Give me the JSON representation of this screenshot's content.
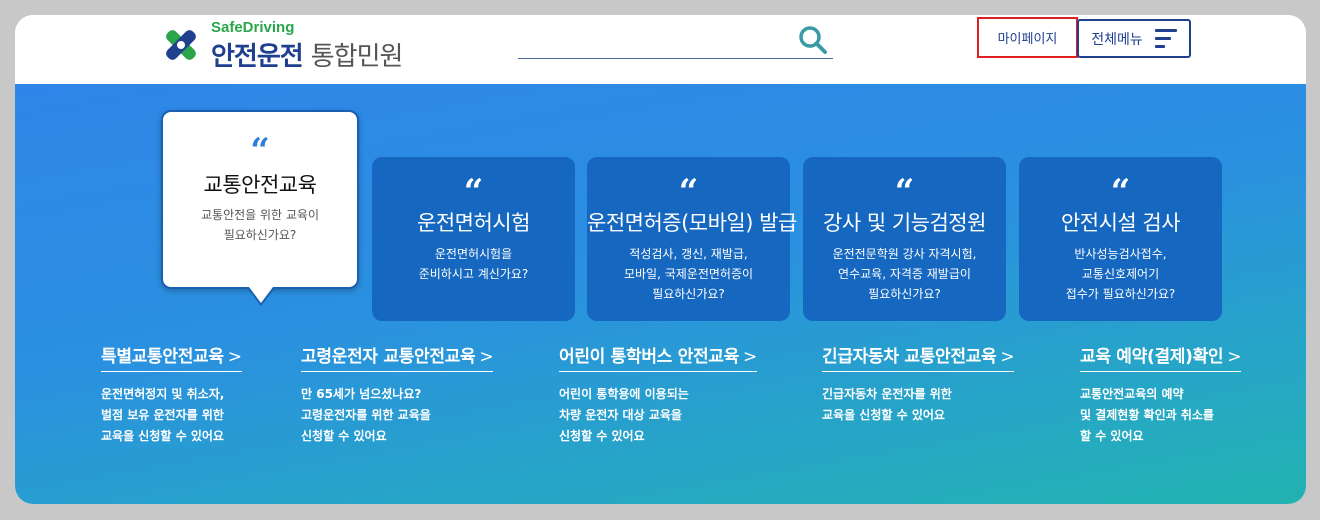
{
  "logo": {
    "en": "SafeDriving",
    "ko_main": "안전운전",
    "ko_sub": "통합민원"
  },
  "search": {
    "placeholder": ""
  },
  "header": {
    "mypage_label": "마이페이지",
    "menu_label": "전체메뉴"
  },
  "cards": [
    {
      "quote": "“",
      "title": "교통안전교육",
      "desc": "교통안전을 위한 교육이\n필요하신가요?"
    },
    {
      "quote": "“",
      "title": "운전면허시험",
      "desc": "운전면허시험을\n준비하시고 계신가요?"
    },
    {
      "quote": "“",
      "title": "운전면허증(모바일) 발급",
      "desc": "적성검사, 갱신, 재발급,\n모바일, 국제운전면허증이\n필요하신가요?"
    },
    {
      "quote": "“",
      "title": "강사 및 기능검정원",
      "desc": "운전전문학원 강사 자격시험,\n연수교육, 자격증 재발급이\n필요하신가요?"
    },
    {
      "quote": "“",
      "title": "안전시설 검사",
      "desc": "반사성능검사접수,\n교통신호제어기\n접수가 필요하신가요?"
    }
  ],
  "links": [
    {
      "title": "특별교통안전교육",
      "arrow": ">",
      "desc": "운전면허정지 및 취소자,\n벌점 보유 운전자를 위한\n교육을 신청할 수 있어요"
    },
    {
      "title": "고령운전자 교통안전교육",
      "arrow": ">",
      "desc": "만 65세가 넘으셨나요?\n고령운전자를 위한 교육을\n신청할 수 있어요"
    },
    {
      "title": "어린이 통학버스 안전교육",
      "arrow": ">",
      "desc": "어린이 통학용에 이용되는\n차량 운전자 대상 교육을\n신청할 수 있어요"
    },
    {
      "title": "긴급자동차 교통안전교육",
      "arrow": ">",
      "desc": "긴급자동차 운전자를 위한\n교육을 신청할 수 있어요"
    },
    {
      "title": "교육 예약(결제)확인",
      "arrow": ">",
      "desc": "교통안전교육의 예약\n및 결제현황 확인과 취소를\n할 수 있어요"
    }
  ],
  "colors": {
    "brand_blue": "#1f3f8f",
    "brand_green": "#2aa54a",
    "card_blue": "#1567c0",
    "highlight_red": "#e02020"
  }
}
